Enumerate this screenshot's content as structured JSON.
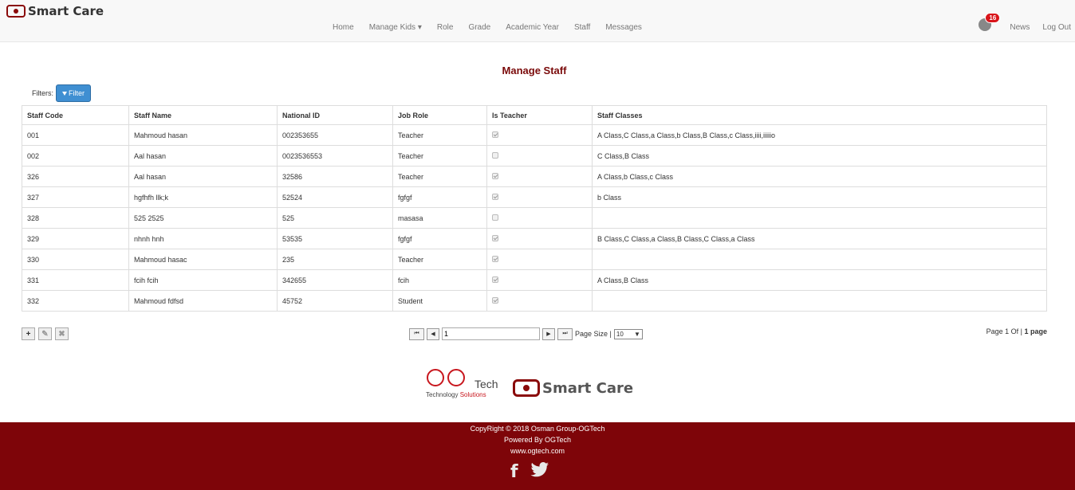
{
  "brand": {
    "name": "Smart Care"
  },
  "nav": {
    "items": [
      "Home",
      "Manage Kids ▾",
      "Role",
      "Grade",
      "Academic Year",
      "Staff",
      "Messages"
    ],
    "notifications_count": "16",
    "news": "News",
    "logout": "Log Out"
  },
  "page": {
    "title": "Manage Staff"
  },
  "filters": {
    "label": "Filters:",
    "button": "Filter"
  },
  "table": {
    "headers": [
      "Staff Code",
      "Staff Name",
      "National ID",
      "Job Role",
      "Is Teacher",
      "Staff Classes"
    ],
    "rows": [
      {
        "code": "001",
        "name": "Mahmoud hasan",
        "national_id": "002353655",
        "role": "Teacher",
        "is_teacher": true,
        "classes": "A Class,C Class,a Class,b Class,B Class,c Class,iiii,iiiiio"
      },
      {
        "code": "002",
        "name": "Aal hasan",
        "national_id": "0023536553",
        "role": "Teacher",
        "is_teacher": false,
        "classes": "C Class,B Class"
      },
      {
        "code": "326",
        "name": "Aal hasan",
        "national_id": "32586",
        "role": "Teacher",
        "is_teacher": true,
        "classes": "A Class,b Class,c Class"
      },
      {
        "code": "327",
        "name": "hgfhfh llk;k",
        "national_id": "52524",
        "role": "fgfgf",
        "is_teacher": true,
        "classes": "b Class"
      },
      {
        "code": "328",
        "name": "525 2525",
        "national_id": "525",
        "role": "masasa",
        "is_teacher": false,
        "classes": ""
      },
      {
        "code": "329",
        "name": "nhnh hnh",
        "national_id": "53535",
        "role": "fgfgf",
        "is_teacher": true,
        "classes": "B Class,C Class,a Class,B Class,C Class,a Class"
      },
      {
        "code": "330",
        "name": "Mahmoud hasac",
        "national_id": "235",
        "role": "Teacher",
        "is_teacher": true,
        "classes": ""
      },
      {
        "code": "331",
        "name": "fcih fcih",
        "national_id": "342655",
        "role": "fcih",
        "is_teacher": true,
        "classes": "A Class,B Class"
      },
      {
        "code": "332",
        "name": "Mahmoud fdfsd",
        "national_id": "45752",
        "role": "Student",
        "is_teacher": true,
        "classes": ""
      }
    ]
  },
  "pager": {
    "current_page": "1",
    "page_size_label": "Page Size |",
    "page_size": "10",
    "info_prefix": "Page 1 Of |",
    "info_total": "1 page"
  },
  "footer_logos": {
    "og_tech": "Tech",
    "og_solutions_1": "Technology",
    "og_solutions_2": "Solutions",
    "smart_care": "Smart Care"
  },
  "footer": {
    "copyright": "CopyRight © 2018 Osman Group-OGTech",
    "powered": "Powered By OGTech",
    "website": "www.ogtech.com"
  }
}
